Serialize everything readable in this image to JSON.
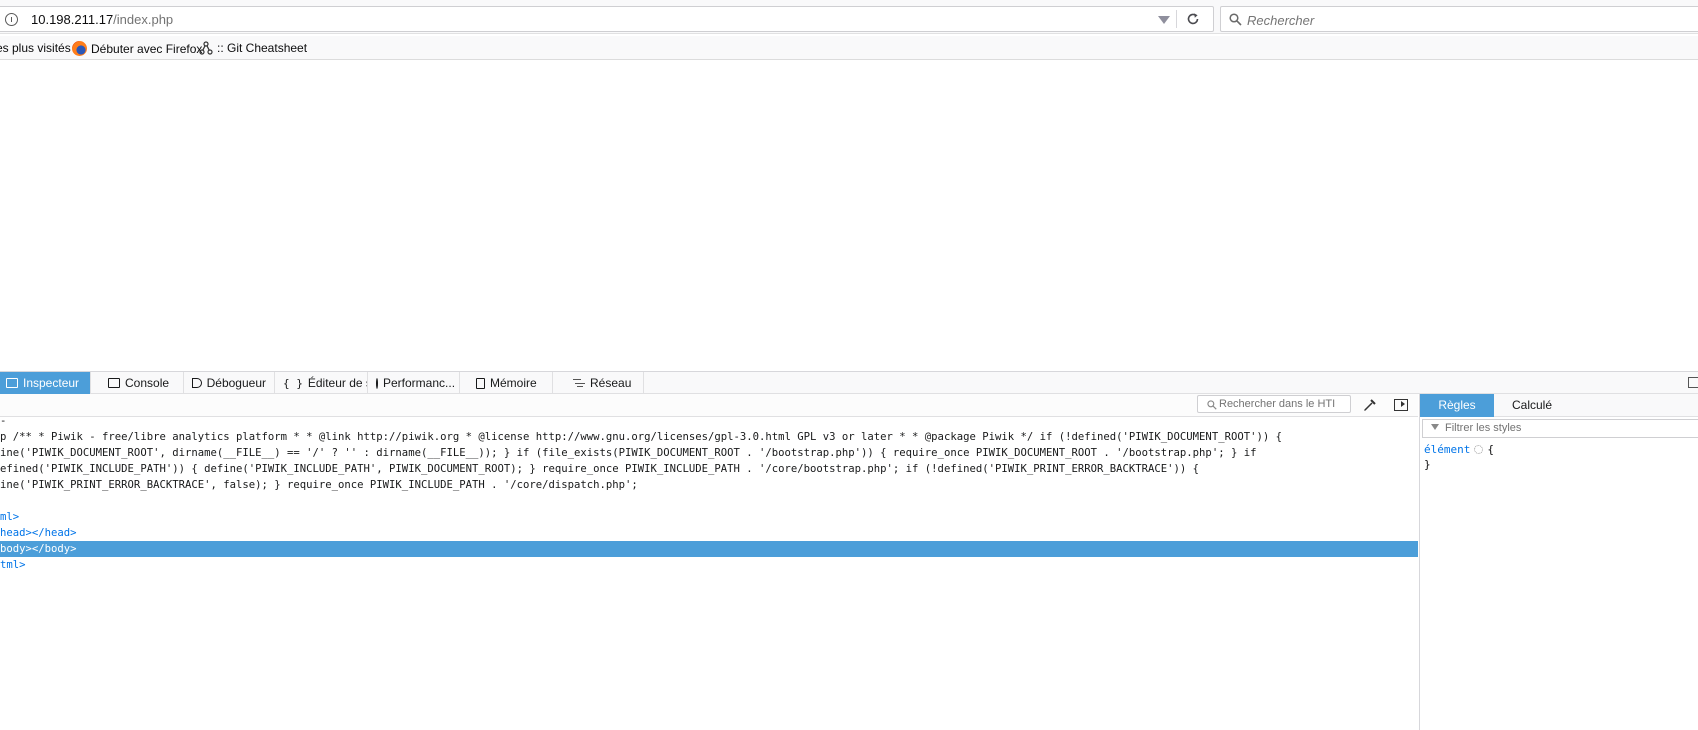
{
  "browser": {
    "url_host": "10.198.211.17",
    "url_path": "/index.php",
    "search_placeholder": "Rechercher"
  },
  "bookmarks": [
    {
      "label": "es plus visités"
    },
    {
      "label": "Débuter avec Firefox"
    },
    {
      "label": ":: Git Cheatsheet"
    }
  ],
  "devtools": {
    "tabs": [
      {
        "label": "Inspecteur",
        "icon": "inspector-icon"
      },
      {
        "label": "Console",
        "icon": "console-icon"
      },
      {
        "label": "Débogueur",
        "icon": "debugger-icon"
      },
      {
        "label": "Éditeur de s...",
        "icon": "style-editor-icon"
      },
      {
        "label": "Performanc...",
        "icon": "performance-icon"
      },
      {
        "label": "Mémoire",
        "icon": "memory-icon"
      },
      {
        "label": "Réseau",
        "icon": "network-icon"
      }
    ],
    "html_search_placeholder": "Rechercher dans le HTI",
    "markup": {
      "lines": [
        "-",
        "p /** * Piwik - free/libre analytics platform * * @link http://piwik.org * @license http://www.gnu.org/licenses/gpl-3.0.html GPL v3 or later * * @package Piwik */ if (!defined('PIWIK_DOCUMENT_ROOT')) {",
        "ine('PIWIK_DOCUMENT_ROOT', dirname(__FILE__) == '/' ? '' : dirname(__FILE__)); } if (file_exists(PIWIK_DOCUMENT_ROOT . '/bootstrap.php')) { require_once PIWIK_DOCUMENT_ROOT . '/bootstrap.php'; } if",
        "efined('PIWIK_INCLUDE_PATH')) { define('PIWIK_INCLUDE_PATH', PIWIK_DOCUMENT_ROOT); } require_once PIWIK_INCLUDE_PATH . '/core/bootstrap.php'; if (!defined('PIWIK_PRINT_ERROR_BACKTRACE')) {",
        "ine('PIWIK_PRINT_ERROR_BACKTRACE', false); } require_once PIWIK_INCLUDE_PATH . '/core/dispatch.php';",
        "ml>",
        "head></head>",
        "body></body>",
        "tml>"
      ]
    },
    "sidebar": {
      "tab_rules": "Règles",
      "tab_computed": "Calculé",
      "filter_placeholder": "Filtrer les styles",
      "rule_selector": "élément",
      "rule_open": "{",
      "rule_close": "}"
    }
  }
}
